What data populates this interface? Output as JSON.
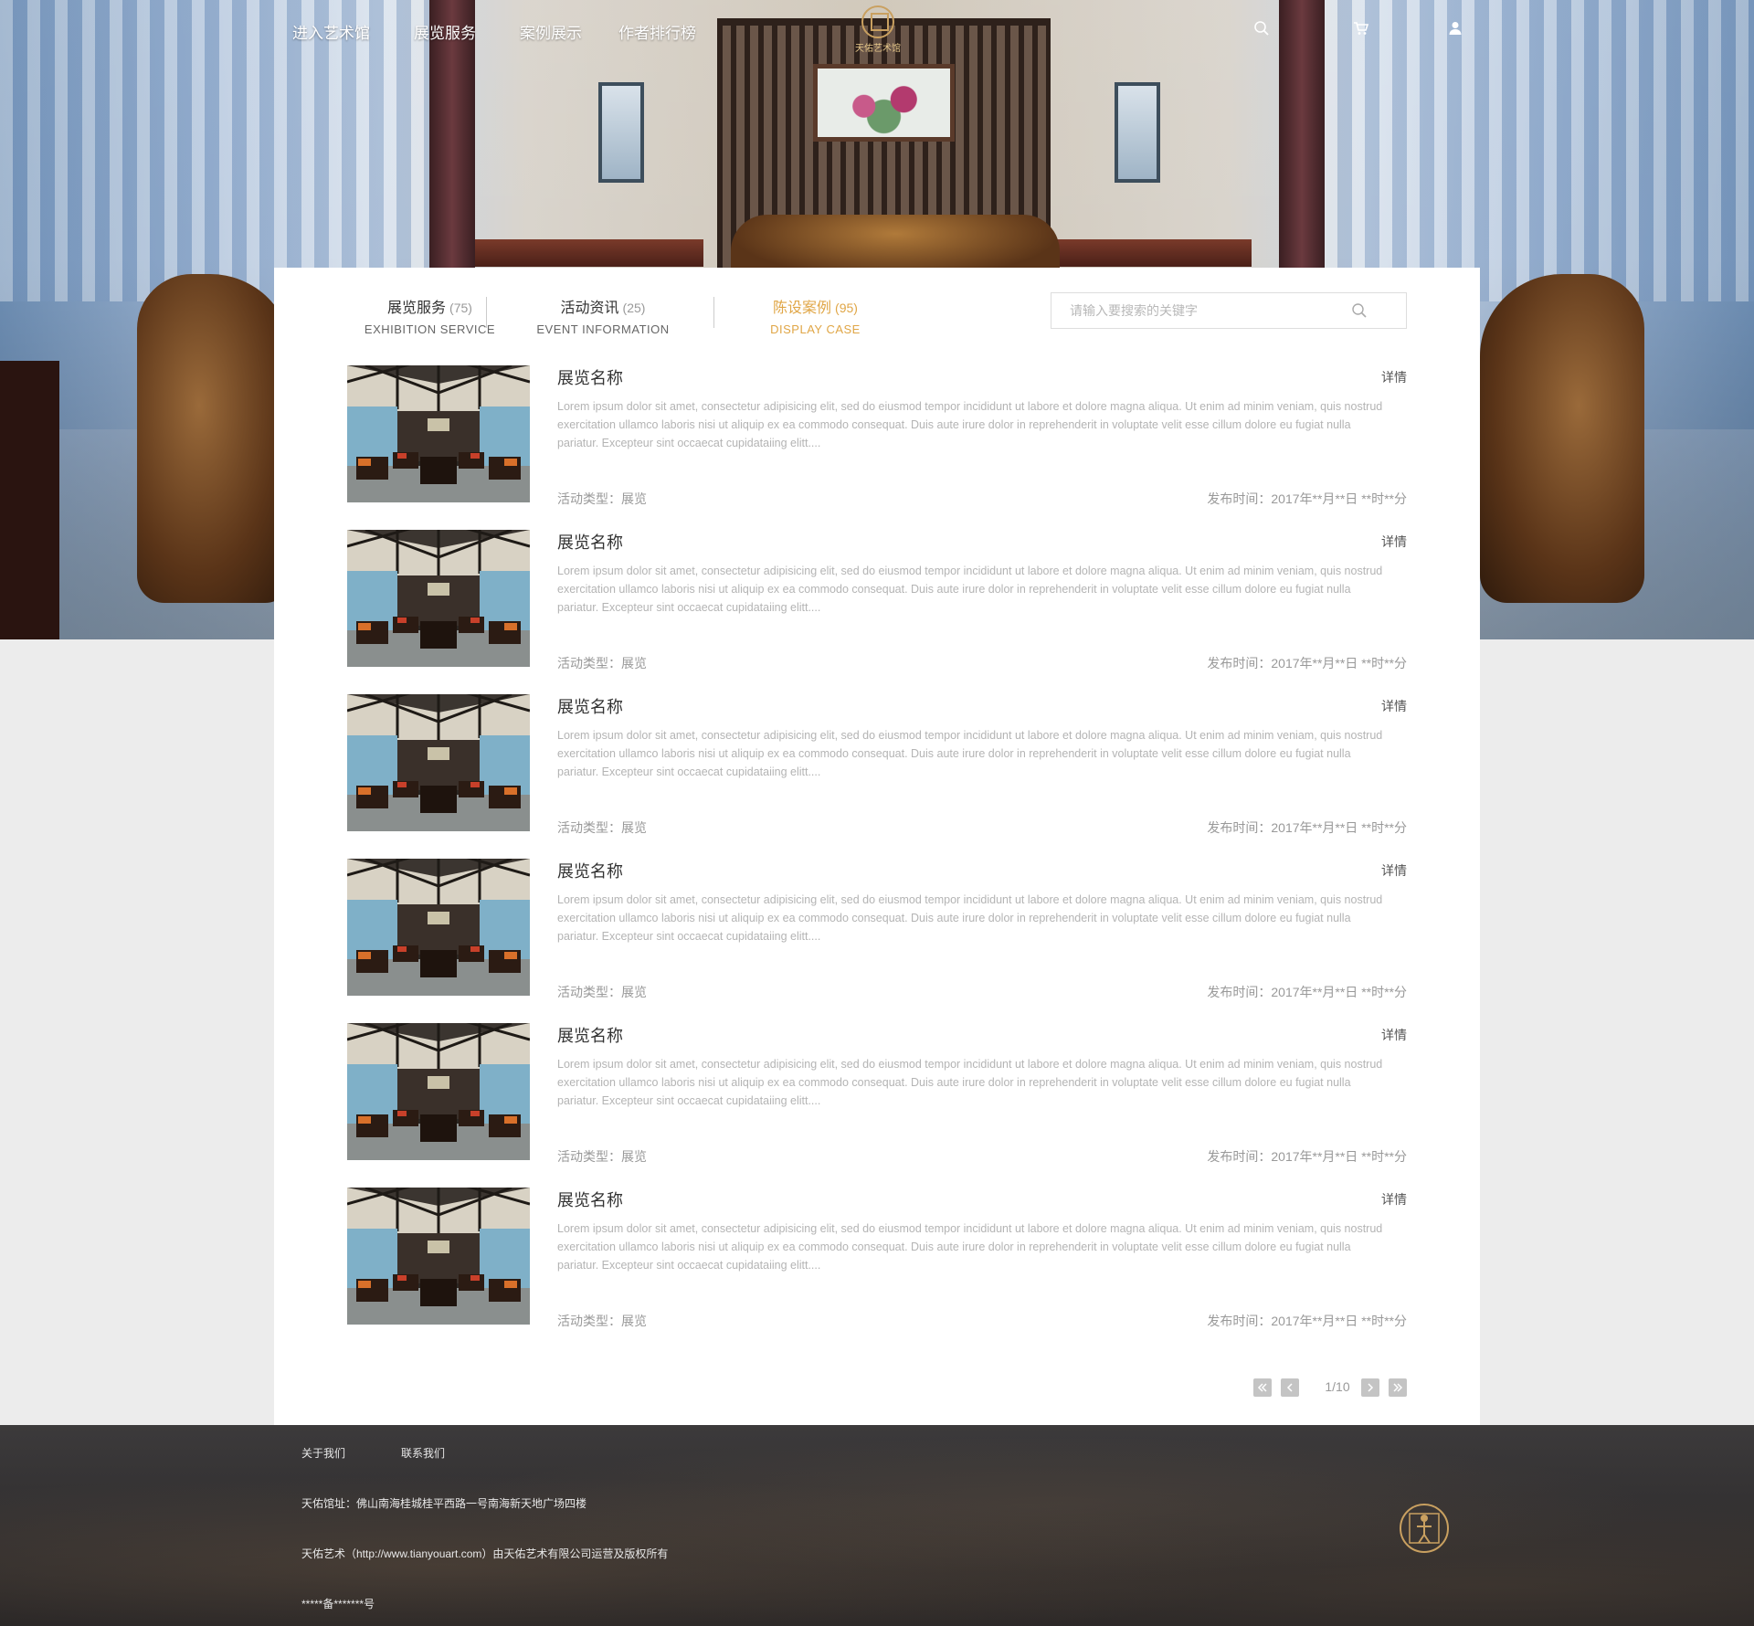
{
  "nav": {
    "links": [
      "进入艺术馆",
      "展览服务",
      "案例展示",
      "作者排行榜"
    ],
    "logo_text": "天佑艺术馆"
  },
  "tabs": [
    {
      "label": "展览服务",
      "count": "(75)",
      "en": "EXHIBITION SERVICE",
      "active": false
    },
    {
      "label": "活动资讯",
      "count": "(25)",
      "en": "EVENT INFORMATION",
      "active": false
    },
    {
      "label": "陈设案例",
      "count": "(95)",
      "en": "DISPLAY CASE",
      "active": true
    }
  ],
  "search": {
    "placeholder": "请输入要搜索的关键字"
  },
  "items": [
    {
      "title": "展览名称",
      "detail": "详情",
      "desc": "Lorem ipsum dolor sit amet, consectetur adipisicing elit, sed do eiusmod tempor incididunt ut labore et dolore magna aliqua. Ut enim ad minim veniam, quis nostrud exercitation ullamco laboris nisi ut aliquip ex ea commodo consequat. Duis aute irure dolor in reprehenderit in voluptate velit esse cillum dolore eu fugiat nulla pariatur. Excepteur sint occaecat cupidataiing elitt....",
      "type": "活动类型：展览",
      "date": "发布时间：2017年**月**日 **时**分"
    },
    {
      "title": "展览名称",
      "detail": "详情",
      "desc": "Lorem ipsum dolor sit amet, consectetur adipisicing elit, sed do eiusmod tempor incididunt ut labore et dolore magna aliqua. Ut enim ad minim veniam, quis nostrud exercitation ullamco laboris nisi ut aliquip ex ea commodo consequat. Duis aute irure dolor in reprehenderit in voluptate velit esse cillum dolore eu fugiat nulla pariatur. Excepteur sint occaecat cupidataiing elitt....",
      "type": "活动类型：展览",
      "date": "发布时间：2017年**月**日 **时**分"
    },
    {
      "title": "展览名称",
      "detail": "详情",
      "desc": "Lorem ipsum dolor sit amet, consectetur adipisicing elit, sed do eiusmod tempor incididunt ut labore et dolore magna aliqua. Ut enim ad minim veniam, quis nostrud exercitation ullamco laboris nisi ut aliquip ex ea commodo consequat. Duis aute irure dolor in reprehenderit in voluptate velit esse cillum dolore eu fugiat nulla pariatur. Excepteur sint occaecat cupidataiing elitt....",
      "type": "活动类型：展览",
      "date": "发布时间：2017年**月**日 **时**分"
    },
    {
      "title": "展览名称",
      "detail": "详情",
      "desc": "Lorem ipsum dolor sit amet, consectetur adipisicing elit, sed do eiusmod tempor incididunt ut labore et dolore magna aliqua. Ut enim ad minim veniam, quis nostrud exercitation ullamco laboris nisi ut aliquip ex ea commodo consequat. Duis aute irure dolor in reprehenderit in voluptate velit esse cillum dolore eu fugiat nulla pariatur. Excepteur sint occaecat cupidataiing elitt....",
      "type": "活动类型：展览",
      "date": "发布时间：2017年**月**日 **时**分"
    },
    {
      "title": "展览名称",
      "detail": "详情",
      "desc": "Lorem ipsum dolor sit amet, consectetur adipisicing elit, sed do eiusmod tempor incididunt ut labore et dolore magna aliqua. Ut enim ad minim veniam, quis nostrud exercitation ullamco laboris nisi ut aliquip ex ea commodo consequat. Duis aute irure dolor in reprehenderit in voluptate velit esse cillum dolore eu fugiat nulla pariatur. Excepteur sint occaecat cupidataiing elitt....",
      "type": "活动类型：展览",
      "date": "发布时间：2017年**月**日 **时**分"
    },
    {
      "title": "展览名称",
      "detail": "详情",
      "desc": "Lorem ipsum dolor sit amet, consectetur adipisicing elit, sed do eiusmod tempor incididunt ut labore et dolore magna aliqua. Ut enim ad minim veniam, quis nostrud exercitation ullamco laboris nisi ut aliquip ex ea commodo consequat. Duis aute irure dolor in reprehenderit in voluptate velit esse cillum dolore eu fugiat nulla pariatur. Excepteur sint occaecat cupidataiing elitt....",
      "type": "活动类型：展览",
      "date": "发布时间：2017年**月**日 **时**分"
    }
  ],
  "pagination": {
    "text": "1/10",
    "current": 1,
    "total": 10
  },
  "footer": {
    "links": [
      "关于我们",
      "联系我们"
    ],
    "address": "天佑馆址：佛山南海桂城桂平西路一号南海新天地广场四楼",
    "copyright": "天佑艺术（http://www.tianyouart.com）由天佑艺术有限公司运营及版权所有",
    "icp": "*****备*******号"
  },
  "colors": {
    "accent": "#e0a646",
    "panel": "#ffffff",
    "page_bg": "#ececec",
    "footer": "#2f2d2e"
  }
}
